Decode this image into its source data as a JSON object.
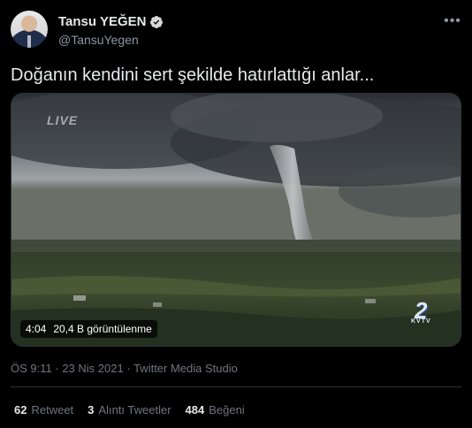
{
  "user": {
    "display_name": "Tansu YEĞEN",
    "handle": "@TansuYegen"
  },
  "tweet": {
    "text": "Doğanın kendini sert şekilde hatırlattığı anlar...",
    "time": "ÖS 9:11",
    "date": "23 Nis 2021",
    "source": "Twitter Media Studio",
    "meta_separator": "·"
  },
  "media": {
    "overlay_live": "LIVE",
    "station_number": "2",
    "station_call": "KVTV",
    "duration": "4:04",
    "views": "20,4 B görüntülenme"
  },
  "stats": {
    "retweets": {
      "count": "62",
      "label": "Retweet"
    },
    "quotes": {
      "count": "3",
      "label": "Alıntı Tweetler"
    },
    "likes": {
      "count": "484",
      "label": "Beğeni"
    }
  },
  "icons": {
    "verified": "verified-badge-icon",
    "more": "more-options-icon"
  },
  "colors": {
    "background": "#000000",
    "verified": "#d9d9d9",
    "secondary_text": "#6e767d"
  }
}
